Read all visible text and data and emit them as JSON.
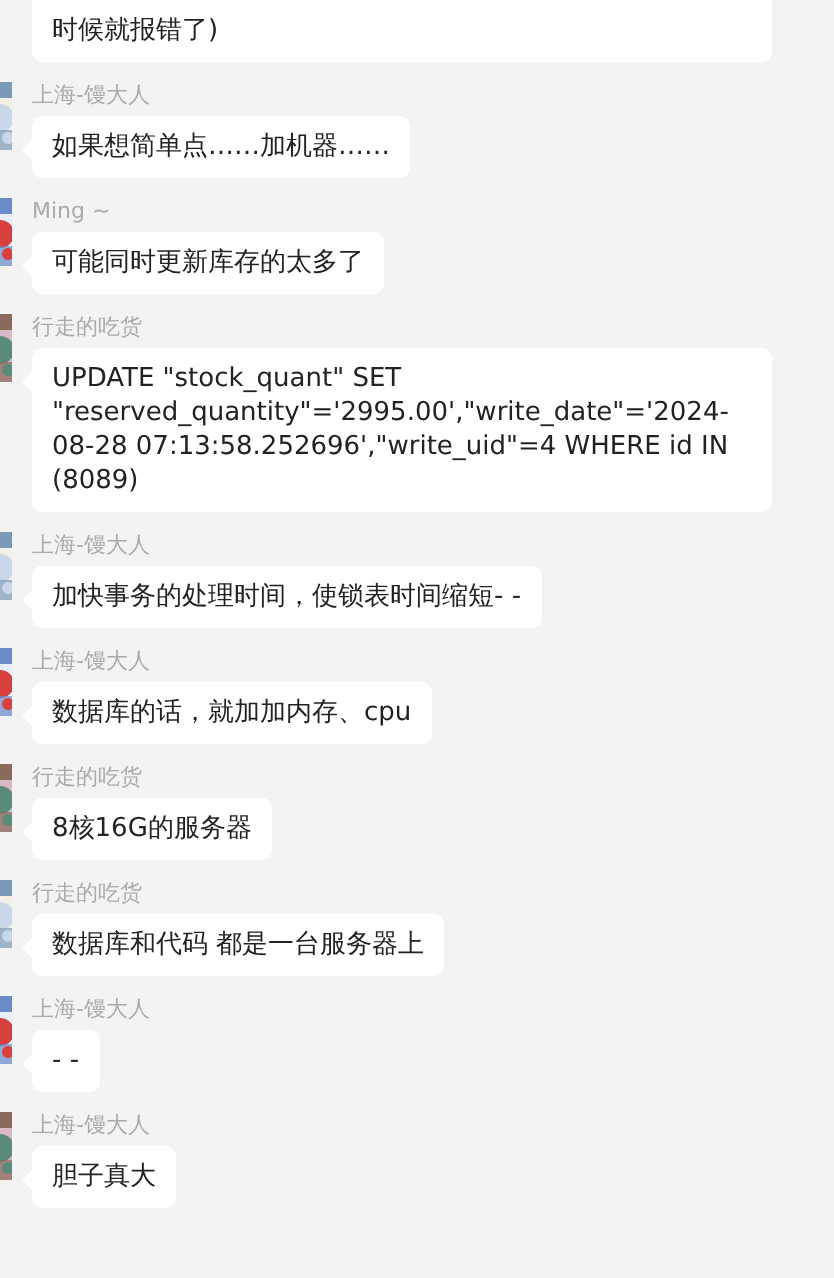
{
  "messages": [
    {
      "text": "时候就报错了)"
    },
    {
      "sender": "上海-馒大人",
      "text": "如果想简单点……加机器……"
    },
    {
      "sender": "Ming ~",
      "text": "可能同时更新库存的太多了"
    },
    {
      "sender": "行走的吃货",
      "text": "UPDATE \"stock_quant\" SET \"reserved_quantity\"='2995.00',\"write_date\"='2024-08-28 07:13:58.252696',\"write_uid\"=4 WHERE id IN (8089)"
    },
    {
      "sender": "上海-馒大人",
      "text": "加快事务的处理时间，使锁表时间缩短- -"
    },
    {
      "sender": "上海-馒大人",
      "text": "数据库的话，就加加内存、cpu"
    },
    {
      "sender": "行走的吃货",
      "text": "8核16G的服务器"
    },
    {
      "sender": "行走的吃货",
      "text": "数据库和代码 都是一台服务器上"
    },
    {
      "sender": "上海-馒大人",
      "text": "- -"
    },
    {
      "sender": "上海-馒大人",
      "text": "胆子真大"
    }
  ]
}
